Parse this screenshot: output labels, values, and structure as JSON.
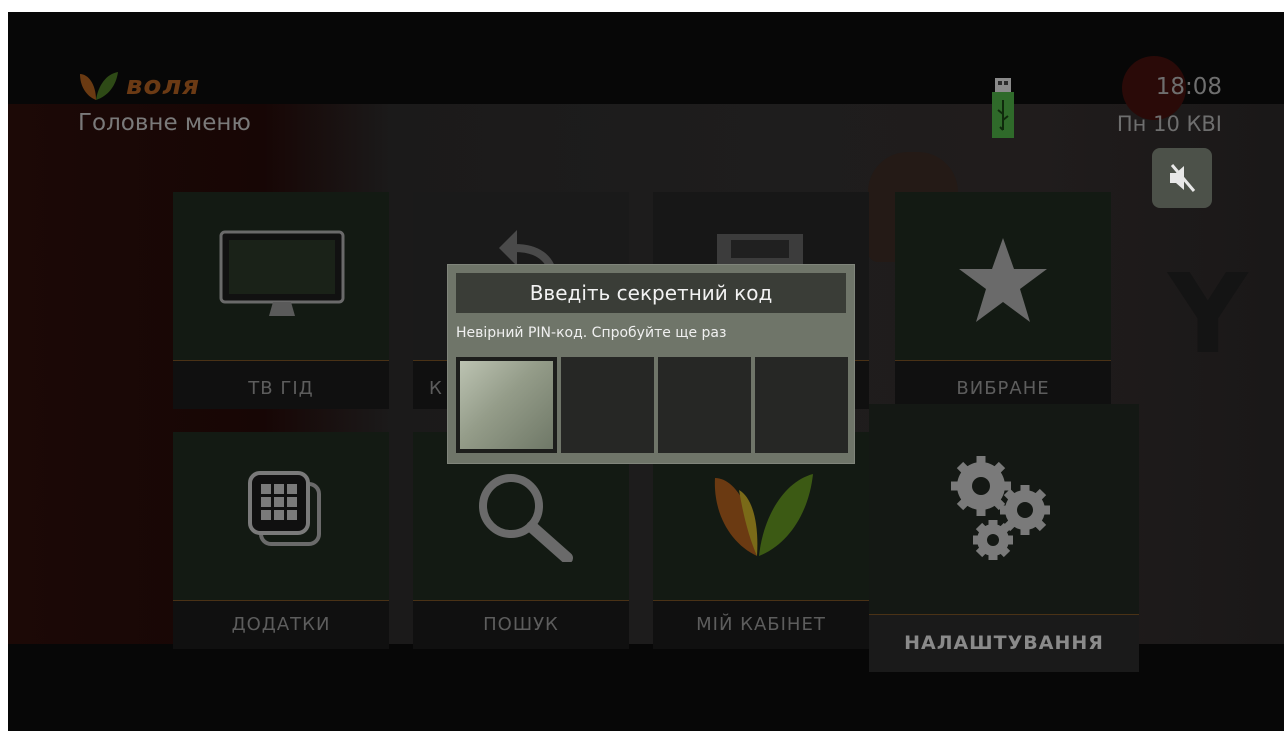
{
  "header": {
    "brand": "воля",
    "menu_title": "Головне меню",
    "time": "18:08",
    "date": "Пн 10 КВІ"
  },
  "status_icons": [
    "usb-icon",
    "mute-icon"
  ],
  "tiles": [
    {
      "label": "ТВ ГІД",
      "icon": "monitor-icon"
    },
    {
      "label": "К",
      "icon": "back-arrow-icon"
    },
    {
      "label": "",
      "icon": "film-icon"
    },
    {
      "label": "ВИБРАНЕ",
      "icon": "star-icon"
    },
    {
      "label": "ДОДАТКИ",
      "icon": "apps-icon"
    },
    {
      "label": "ПОШУК",
      "icon": "search-icon"
    },
    {
      "label": "МІЙ КАБІНЕТ",
      "icon": "volia-logo-icon"
    },
    {
      "label": "НАЛАШТУВАННЯ",
      "icon": "gears-icon",
      "selected": true
    }
  ],
  "pin_dialog": {
    "title": "Введіть секретний код",
    "message": "Невірний PIN-код. Спробуйте ще раз",
    "digits": [
      "",
      "",
      "",
      ""
    ],
    "active_index": 0
  },
  "colors": {
    "dialog_bg": "#6f7569",
    "dialog_header": "#3a3d37",
    "accent_orange": "#d9791f",
    "accent_green": "#5a8a2a"
  }
}
